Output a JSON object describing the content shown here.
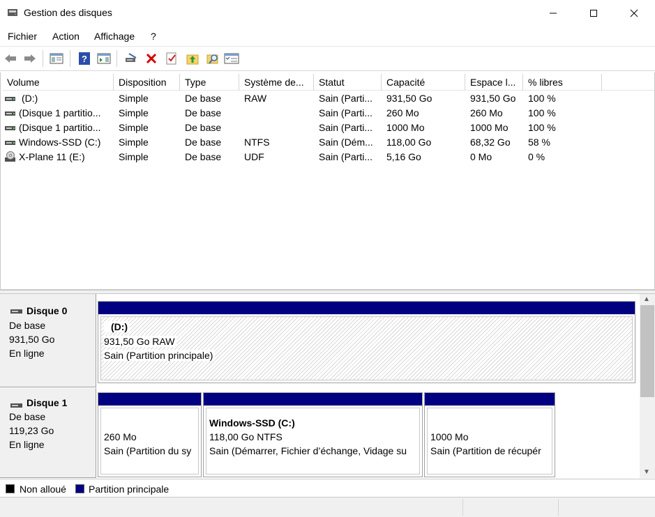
{
  "window": {
    "title": "Gestion des disques",
    "controls": [
      "minimize",
      "maximize",
      "close"
    ]
  },
  "menu": [
    "Fichier",
    "Action",
    "Affichage",
    "?"
  ],
  "toolbar": {
    "icons": [
      "back-icon",
      "forward-icon",
      "properties-pane-icon",
      "help-icon",
      "action-pane-icon",
      "connect-disk-icon",
      "delete-icon",
      "check-icon",
      "up-folder-icon",
      "search-icon",
      "list-view-icon"
    ]
  },
  "volume_list": {
    "columns": [
      "Volume",
      "Disposition",
      "Type",
      "Système de...",
      "Statut",
      "Capacité",
      "Espace l...",
      "% libres"
    ],
    "rows": [
      {
        "icon": "drive-icon",
        "volume": "(D:)",
        "layout": "Simple",
        "type": "De base",
        "fs": "RAW",
        "status": "Sain (Parti...",
        "capacity": "931,50 Go",
        "free": "931,50 Go",
        "pct": "100 %"
      },
      {
        "icon": "drive-icon",
        "volume": "(Disque 1 partitio...",
        "layout": "Simple",
        "type": "De base",
        "fs": "",
        "status": "Sain (Parti...",
        "capacity": "260 Mo",
        "free": "260 Mo",
        "pct": "100 %"
      },
      {
        "icon": "drive-icon",
        "volume": "(Disque 1 partitio...",
        "layout": "Simple",
        "type": "De base",
        "fs": "",
        "status": "Sain (Parti...",
        "capacity": "1000 Mo",
        "free": "1000 Mo",
        "pct": "100 %"
      },
      {
        "icon": "drive-icon",
        "volume": "Windows-SSD (C:)",
        "layout": "Simple",
        "type": "De base",
        "fs": "NTFS",
        "status": "Sain (Dém...",
        "capacity": "118,00 Go",
        "free": "68,32 Go",
        "pct": "58 %"
      },
      {
        "icon": "cd-drive-icon",
        "volume": "X-Plane 11 (E:)",
        "layout": "Simple",
        "type": "De base",
        "fs": "UDF",
        "status": "Sain (Parti...",
        "capacity": "5,16 Go",
        "free": "0 Mo",
        "pct": "0 %"
      }
    ]
  },
  "disks": [
    {
      "name": "Disque 0",
      "type": "De base",
      "size": "931,50 Go",
      "state": "En ligne",
      "partitions": [
        {
          "title": "(D:)",
          "line1": "931,50 Go RAW",
          "line2": "Sain (Partition principale)"
        }
      ]
    },
    {
      "name": "Disque 1",
      "type": "De base",
      "size": "119,23 Go",
      "state": "En ligne",
      "partitions": [
        {
          "title": "",
          "line1": "260 Mo",
          "line2": "Sain (Partition du sy"
        },
        {
          "title": "Windows-SSD  (C:)",
          "line1": "118,00 Go NTFS",
          "line2": "Sain (Démarrer, Fichier d’échange, Vidage su"
        },
        {
          "title": "",
          "line1": "1000 Mo",
          "line2": "Sain (Partition de récupér"
        }
      ]
    }
  ],
  "legend": [
    {
      "label": "Non alloué",
      "color": "#000000"
    },
    {
      "label": "Partition principale",
      "color": "#000080"
    }
  ],
  "colors": {
    "partition_bar": "#000080",
    "accent_red": "#d40000"
  }
}
